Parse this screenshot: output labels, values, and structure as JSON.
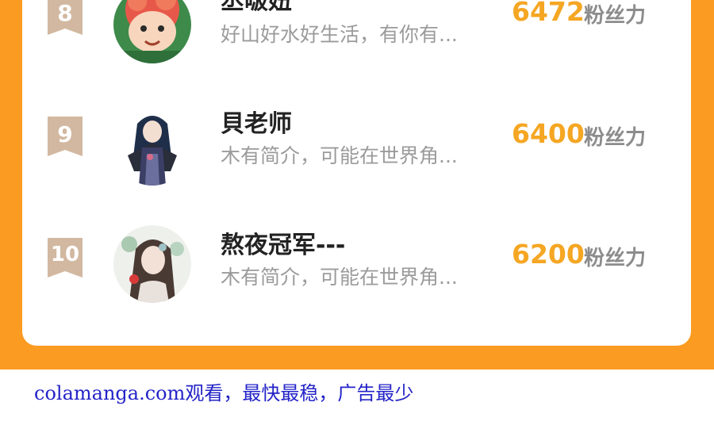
{
  "leaderboard": {
    "fans_label": "粉丝力",
    "entries": [
      {
        "rank": "8",
        "name": "丞啵妞",
        "bio": "好山好水好生活，有你有...",
        "fans": "6472"
      },
      {
        "rank": "9",
        "name": "貝老师",
        "bio": "木有简介，可能在世界角...",
        "fans": "6400"
      },
      {
        "rank": "10",
        "name": "熬夜冠军---",
        "bio": "木有简介，可能在世界角...",
        "fans": "6200"
      }
    ]
  },
  "footer": {
    "text": "colamanga.com观看，最快最稳，广告最少"
  },
  "colors": {
    "accent": "#fc9b22",
    "fans_number": "#f5a623",
    "badge": "#d2b8a0",
    "footer_link": "#2323c8"
  }
}
